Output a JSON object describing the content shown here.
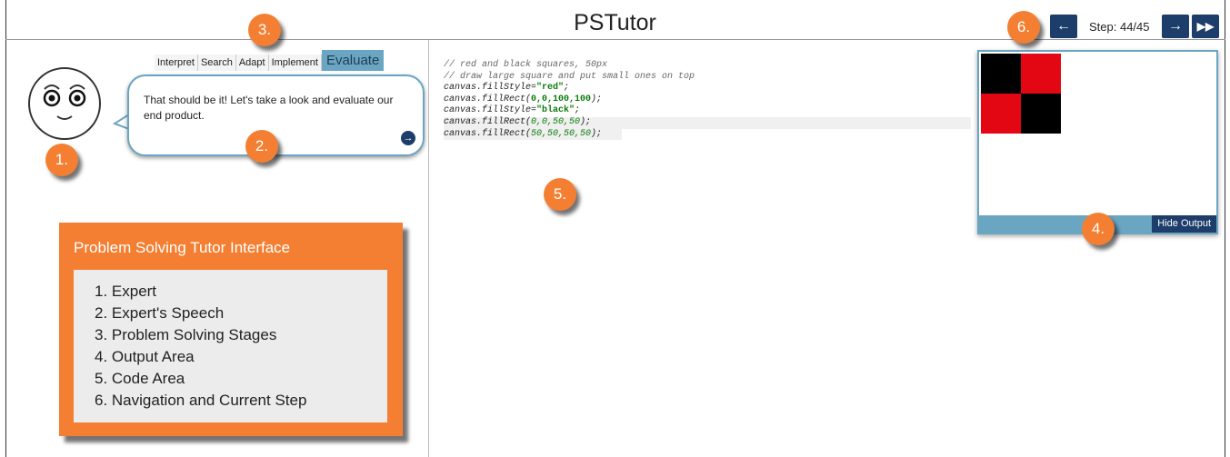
{
  "app": {
    "title": "PSTutor"
  },
  "navigation": {
    "prev_icon": "arrow-left-icon",
    "next_icon": "arrow-right-icon",
    "last_icon": "skip-to-end-icon",
    "step_label": "Step: 44/45"
  },
  "stages": [
    {
      "label": "Interpret",
      "active": false
    },
    {
      "label": "Search",
      "active": false
    },
    {
      "label": "Adapt",
      "active": false
    },
    {
      "label": "Implement",
      "active": false
    },
    {
      "label": "Evaluate",
      "active": true
    }
  ],
  "expert": {
    "speech": "That should be it! Let's take a look and evaluate our end product.",
    "next_icon": "arrow-right-circle-icon"
  },
  "code": {
    "lines": [
      "// red and black squares, 50px",
      "// draw large square and put small ones on top",
      "canvas.fillStyle=\"red\";",
      "canvas.fillRect(0,0,100,100);",
      "canvas.fillStyle=\"black\";",
      "canvas.fillRect(0,0,50,50);",
      "canvas.fillRect(50,50,50,50);"
    ]
  },
  "output": {
    "hide_label": "Hide Output",
    "colors": {
      "red": "#e30613",
      "black": "#000000"
    }
  },
  "badges": [
    "1.",
    "2.",
    "3.",
    "4.",
    "5.",
    "6."
  ],
  "legend": {
    "title": "Problem Solving Tutor Interface",
    "items": [
      "1. Expert",
      "2. Expert's Speech",
      "3. Problem Solving Stages",
      "4. Output Area",
      "5. Code Area",
      "6. Navigation and Current Step"
    ]
  },
  "colors": {
    "accent_orange": "#f47f32",
    "nav_blue": "#1d3d6b",
    "panel_blue": "#6aa5c2"
  }
}
